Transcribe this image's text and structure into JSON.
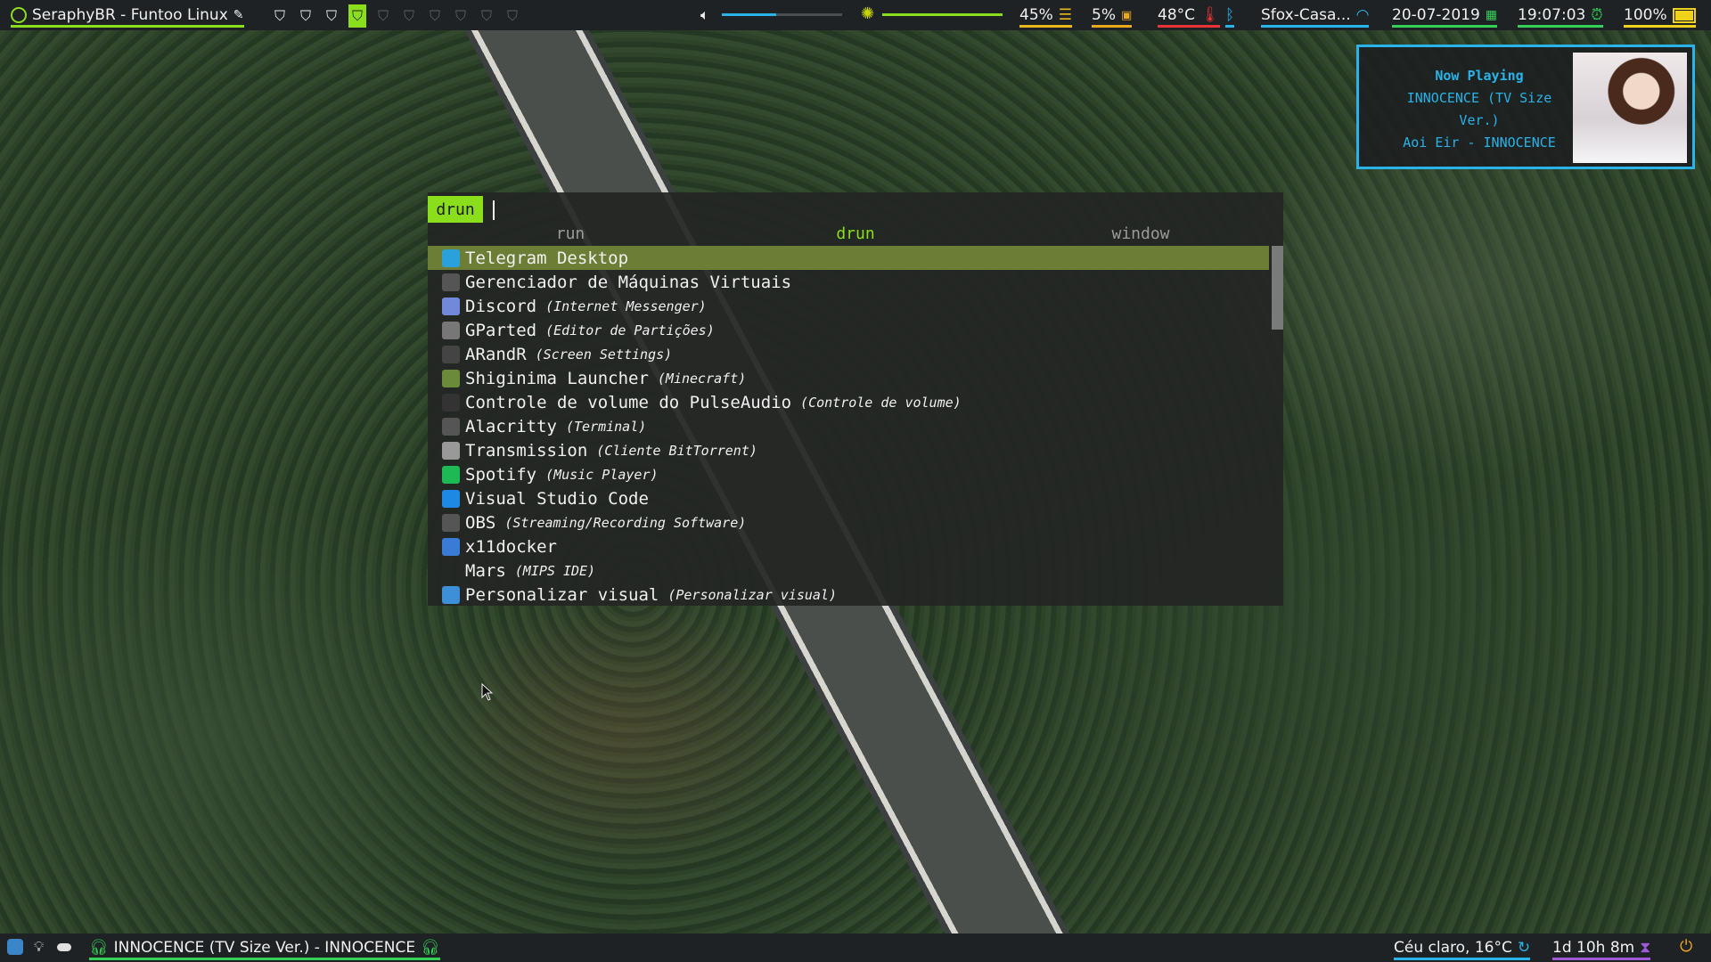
{
  "top_bar": {
    "user_title": "SeraphyBR - Funtoo Linux",
    "workspaces": [
      {
        "icon": "leaf-icon",
        "state": "occupied"
      },
      {
        "icon": "leaf-icon",
        "state": "occupied"
      },
      {
        "icon": "leaf-icon",
        "state": "occupied"
      },
      {
        "icon": "leaf-icon",
        "state": "active"
      },
      {
        "icon": "leaf-icon",
        "state": "empty"
      },
      {
        "icon": "leaf-icon",
        "state": "empty"
      },
      {
        "icon": "leaf-icon",
        "state": "empty"
      },
      {
        "icon": "leaf-icon",
        "state": "empty"
      },
      {
        "icon": "leaf-icon",
        "state": "empty"
      },
      {
        "icon": "leaf-icon",
        "state": "empty"
      }
    ],
    "volume_level": 0.45,
    "brightness_level": 1.0,
    "memory": "45%",
    "cpu": "5%",
    "temperature": "48°C",
    "wifi_name": "Sfox-Casa...",
    "date": "20-07-2019",
    "time": "19:07:03",
    "battery": "100%"
  },
  "now_playing": {
    "title": "Now Playing",
    "line1": "INNOCENCE (TV Size",
    "line2": "Ver.)",
    "line3": "Aoi Eir - INNOCENCE"
  },
  "launcher": {
    "prompt": "drun",
    "input_value": "",
    "modes": [
      "run",
      "drun",
      "window"
    ],
    "active_mode": "drun",
    "scroll_position": 0.0,
    "items": [
      {
        "name": "Telegram Desktop",
        "desc": "",
        "icon": "telegram-icon",
        "color": "#2aa1da"
      },
      {
        "name": "Gerenciador de Máquinas Virtuais",
        "desc": "",
        "icon": "virt-manager-icon",
        "color": "#555555"
      },
      {
        "name": "Discord",
        "desc": "(Internet Messenger)",
        "icon": "discord-icon",
        "color": "#7289da"
      },
      {
        "name": "GParted",
        "desc": "(Editor de Partições)",
        "icon": "gparted-icon",
        "color": "#777777"
      },
      {
        "name": "ARandR",
        "desc": "(Screen Settings)",
        "icon": "monitor-icon",
        "color": "#444444"
      },
      {
        "name": "Shiginima Launcher",
        "desc": "(Minecraft)",
        "icon": "minecraft-icon",
        "color": "#6b8a3a"
      },
      {
        "name": "Controle de volume do PulseAudio",
        "desc": "(Controle de volume)",
        "icon": "pulseaudio-icon",
        "color": "#333333"
      },
      {
        "name": "Alacritty",
        "desc": "(Terminal)",
        "icon": "alacritty-icon",
        "color": "#555555"
      },
      {
        "name": "Transmission",
        "desc": "(Cliente BitTorrent)",
        "icon": "transmission-icon",
        "color": "#999999"
      },
      {
        "name": "Spotify",
        "desc": "(Music Player)",
        "icon": "spotify-icon",
        "color": "#1db954"
      },
      {
        "name": "Visual Studio Code",
        "desc": "",
        "icon": "vscode-icon",
        "color": "#1e88e5"
      },
      {
        "name": "OBS",
        "desc": "(Streaming/Recording Software)",
        "icon": "obs-icon",
        "color": "#555555"
      },
      {
        "name": "x11docker",
        "desc": "",
        "icon": "x11docker-icon",
        "color": "#3a7bd5"
      },
      {
        "name": "Mars",
        "desc": "(MIPS IDE)",
        "icon": "",
        "color": "transparent"
      },
      {
        "name": "Personalizar visual",
        "desc": "(Personalizar visual)",
        "icon": "appearance-icon",
        "color": "#3d8fd8"
      }
    ]
  },
  "bottom_bar": {
    "media": "INNOCENCE (TV Size Ver.) - INNOCENCE",
    "weather": "Céu claro, 16°C",
    "uptime": "1d 10h 8m"
  }
}
